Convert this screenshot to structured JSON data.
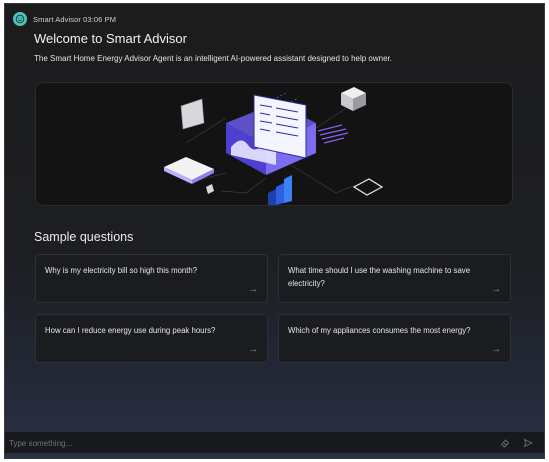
{
  "message": {
    "sender": "Smart Advisor",
    "time": "03:06 PM",
    "sender_line": "Smart Advisor 03:06 PM",
    "avatar_icon": "smiley-icon",
    "title": "Welcome to Smart Advisor",
    "description": "The Smart Home Energy Advisor Agent is an intelligent AI-powered assistant designed to help owner."
  },
  "sample_section": {
    "title": "Sample questions",
    "questions": [
      {
        "text": "Why is my electricity bill so high this month?",
        "icon": "arrow-right-icon"
      },
      {
        "text": "What time should I use the washing machine to save electricity?",
        "icon": "arrow-right-icon"
      },
      {
        "text": "How can I reduce energy use during peak hours?",
        "icon": "arrow-right-icon"
      },
      {
        "text": "Which of my appliances consumes the most energy?",
        "icon": "arrow-right-icon"
      }
    ]
  },
  "input": {
    "placeholder": "Type something...",
    "value": "",
    "clear_icon": "eraser-icon",
    "send_icon": "send-icon"
  },
  "colors": {
    "accent": "#5b9cf5",
    "avatar": "#4fc3b8",
    "background": "#1c1c1c",
    "card_background": "#1b1c1f"
  }
}
